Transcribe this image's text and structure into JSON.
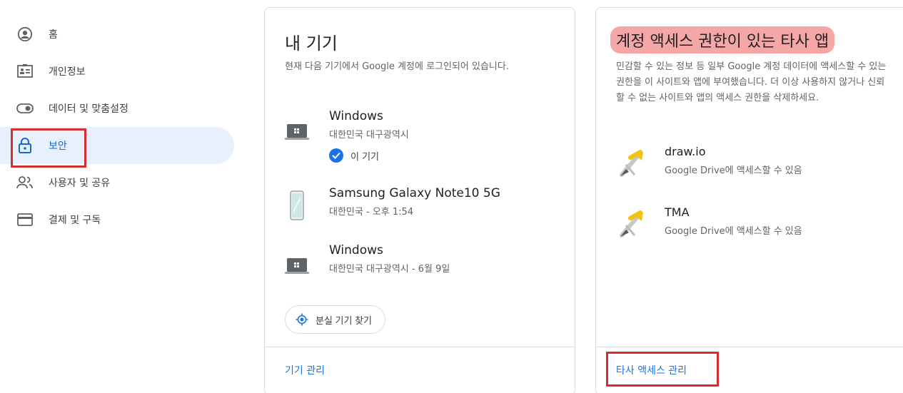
{
  "sidebar": {
    "items": [
      {
        "label": "홈",
        "icon": "account-circle-icon"
      },
      {
        "label": "개인정보",
        "icon": "id-card-icon"
      },
      {
        "label": "데이터 및 맞춤설정",
        "icon": "toggle-icon"
      },
      {
        "label": "보안",
        "icon": "lock-icon",
        "active": true
      },
      {
        "label": "사용자 및 공유",
        "icon": "people-icon"
      },
      {
        "label": "결제 및 구독",
        "icon": "credit-card-icon"
      }
    ]
  },
  "devices_card": {
    "title": "내 기기",
    "description": "현재 다음 기기에서 Google 계정에 로그인되어 있습니다.",
    "devices": [
      {
        "name": "Windows",
        "meta": "대한민국 대구광역시",
        "this_device": "이 기기",
        "icon": "laptop-icon"
      },
      {
        "name": "Samsung Galaxy Note10 5G",
        "meta": "대한민국 - 오후 1:54",
        "icon": "phone-icon"
      },
      {
        "name": "Windows",
        "meta": "대한민국 대구광역시 - 6월 9일",
        "icon": "laptop-icon"
      }
    ],
    "find_button": "분실 기기 찾기",
    "manage_link": "기기 관리"
  },
  "apps_card": {
    "title": "계정 액세스 권한이 있는 타사 앱",
    "description": "민감할 수 있는 정보 등 일부 Google 계정 데이터에 액세스할 수 있는 권한을 이 사이트와 앱에 부여했습니다. 더 이상 사용하지 않거나 신뢰할 수 없는 사이트와 앱의 액세스 권한을 삭제하세요.",
    "apps": [
      {
        "name": "draw.io",
        "meta": "Google Drive에 액세스할 수 있음"
      },
      {
        "name": "TMA",
        "meta": "Google Drive에 액세스할 수 있음"
      }
    ],
    "manage_link": "타사 액세스 관리"
  },
  "colors": {
    "accent": "#1a73e8",
    "highlight": "#f4a7a6",
    "annotation_red": "#d32f2f",
    "active_bg": "#e8f0fe"
  }
}
